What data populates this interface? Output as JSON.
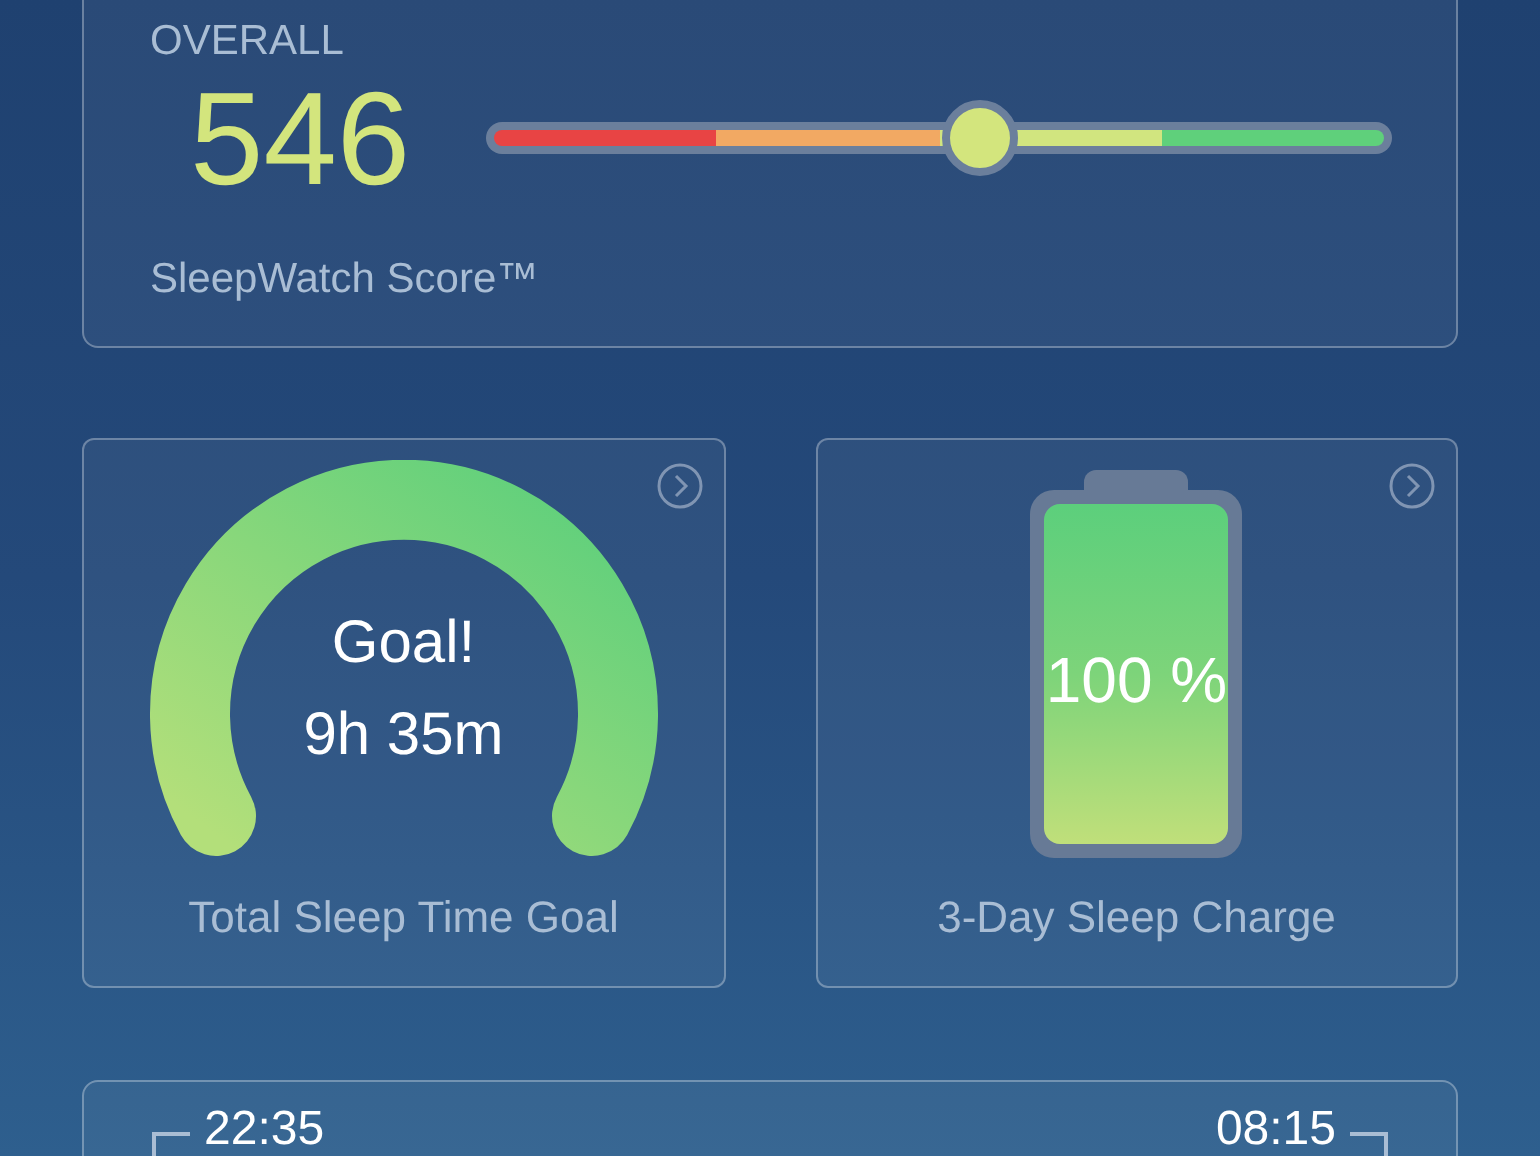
{
  "score_card": {
    "heading": "OVERALL",
    "score": "546",
    "slider": {
      "level": 0.545,
      "segments": [
        {
          "color": "#e84444"
        },
        {
          "color": "#f2a963"
        },
        {
          "color": "#d1e57f"
        },
        {
          "color": "#5fd07b"
        }
      ]
    },
    "caption": "SleepWatch Score™"
  },
  "tiles": [
    {
      "kind": "gauge",
      "lines": [
        "Goal!",
        "9h 35m"
      ],
      "caption": "Total Sleep Time Goal"
    },
    {
      "kind": "battery",
      "reading": "100 %",
      "caption": "3-Day Sleep Charge"
    }
  ],
  "times_card": {
    "start": "22:35",
    "end": "08:15"
  }
}
